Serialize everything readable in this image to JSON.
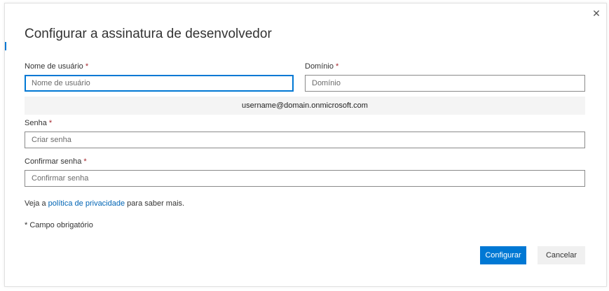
{
  "dialog": {
    "title": "Configurar a assinatura de desenvolvedor",
    "close_icon": "close-icon",
    "close_glyph": "✕"
  },
  "form": {
    "username": {
      "label": "Nome de usuário",
      "required_mark": "*",
      "placeholder": "Nome de usuário",
      "value": ""
    },
    "domain": {
      "label": "Domínio",
      "required_mark": "*",
      "placeholder": "Domínio",
      "value": ""
    },
    "preview_text": "username@domain.onmicrosoft.com",
    "password": {
      "label": "Senha",
      "required_mark": "*",
      "placeholder": "Criar senha",
      "value": ""
    },
    "confirm_password": {
      "label": "Confirmar senha",
      "required_mark": "*",
      "placeholder": "Confirmar senha",
      "value": ""
    }
  },
  "privacy": {
    "prefix": "Veja a ",
    "link_text": "política de privacidade",
    "suffix": " para saber mais."
  },
  "required_note": "* Campo obrigatório",
  "buttons": {
    "primary_label": "Configurar",
    "secondary_label": "Cancelar"
  },
  "colors": {
    "accent": "#0078d4",
    "required": "#a4262c",
    "link": "#0064b4"
  }
}
